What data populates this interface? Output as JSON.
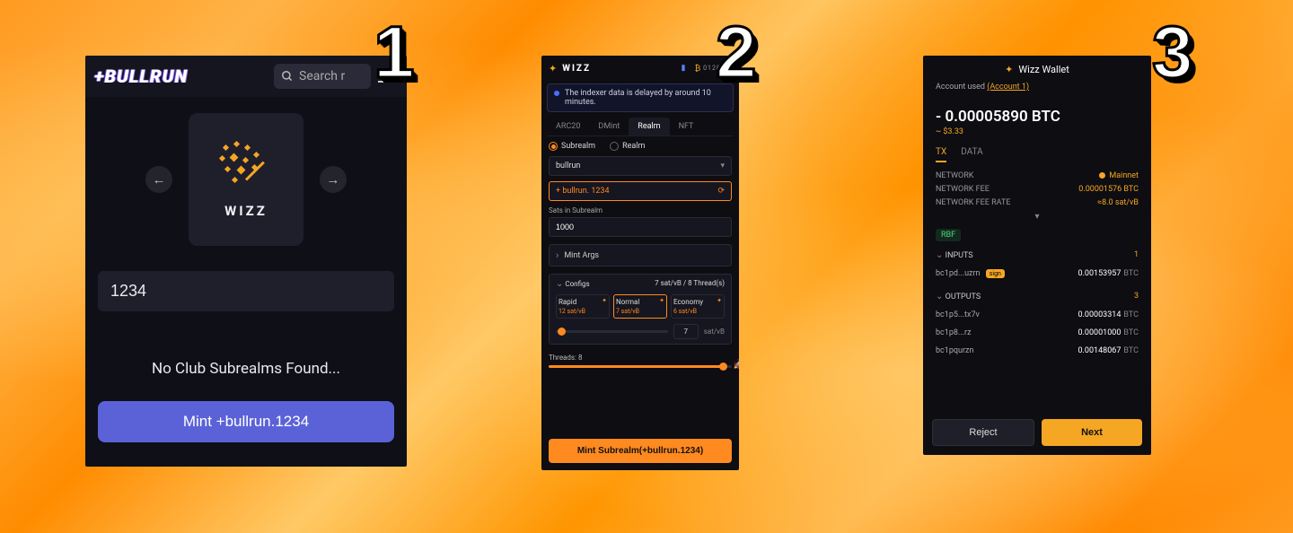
{
  "badges": {
    "one": "1",
    "two": "2",
    "three": "3"
  },
  "panel1": {
    "logo": "+BULLRUN",
    "search_placeholder": "Search r",
    "card_name": "WIZZ",
    "input_value": "1234",
    "empty_msg": "No Club Subrealms Found...",
    "mint_label": "Mint +bullrun.1234"
  },
  "panel2": {
    "logo": "WIZZ",
    "alert": "The indexer data is delayed by around 10 minutes.",
    "tabs": [
      "ARC20",
      "DMint",
      "Realm",
      "NFT"
    ],
    "active_tab": "Realm",
    "radios": {
      "subrealm": "Subrealm",
      "realm": "Realm"
    },
    "parent_value": "bullrun",
    "sub_value": "+ bullrun. 1234",
    "sats_label": "Sats in Subrealm",
    "sats_value": "1000",
    "mint_args_label": "Mint Args",
    "configs_label": "Configs",
    "configs_summary": "7 sat/vB / 8 Thread(s)",
    "fees": {
      "rapid": {
        "name": "Rapid",
        "rate": "12 sat/vB"
      },
      "normal": {
        "name": "Normal",
        "rate": "7 sat/vB"
      },
      "economy": {
        "name": "Economy",
        "rate": "6 sat/vB"
      }
    },
    "fee_value": "7",
    "fee_unit": "sat/vB",
    "threads_label": "Threads: 8",
    "mint_label": "Mint Subrealm(+bullrun.1234)"
  },
  "panel3": {
    "title": "Wizz Wallet",
    "acct_prefix": "Account used",
    "acct_link": "(Account 1)",
    "btc": "- 0.00005890 BTC",
    "usd": "~ $3.33",
    "tabs": {
      "tx": "TX",
      "data": "DATA"
    },
    "network_k": "NETWORK",
    "network_v": "Mainnet",
    "fee_k": "NETWORK FEE",
    "fee_v": "0.00001576 BTC",
    "feerate_k": "NETWORK FEE RATE",
    "feerate_v": "≈8.0 sat/vB",
    "rbf": "RBF",
    "inputs_label": "INPUTS",
    "inputs_count": "1",
    "inputs": [
      {
        "addr": "bc1pd...uzrn",
        "sign": "sign",
        "amt": "0.00153957",
        "unit": "BTC"
      }
    ],
    "outputs_label": "OUTPUTS",
    "outputs_count": "3",
    "outputs": [
      {
        "addr": "bc1p5...tx7v",
        "amt": "0.00003314",
        "unit": "BTC"
      },
      {
        "addr": "bc1p8...rz",
        "amt": "0.00001000",
        "unit": "BTC"
      },
      {
        "addr": "bc1pqurzn",
        "amt": "0.00148067",
        "unit": "BTC"
      }
    ],
    "reject": "Reject",
    "next": "Next"
  }
}
